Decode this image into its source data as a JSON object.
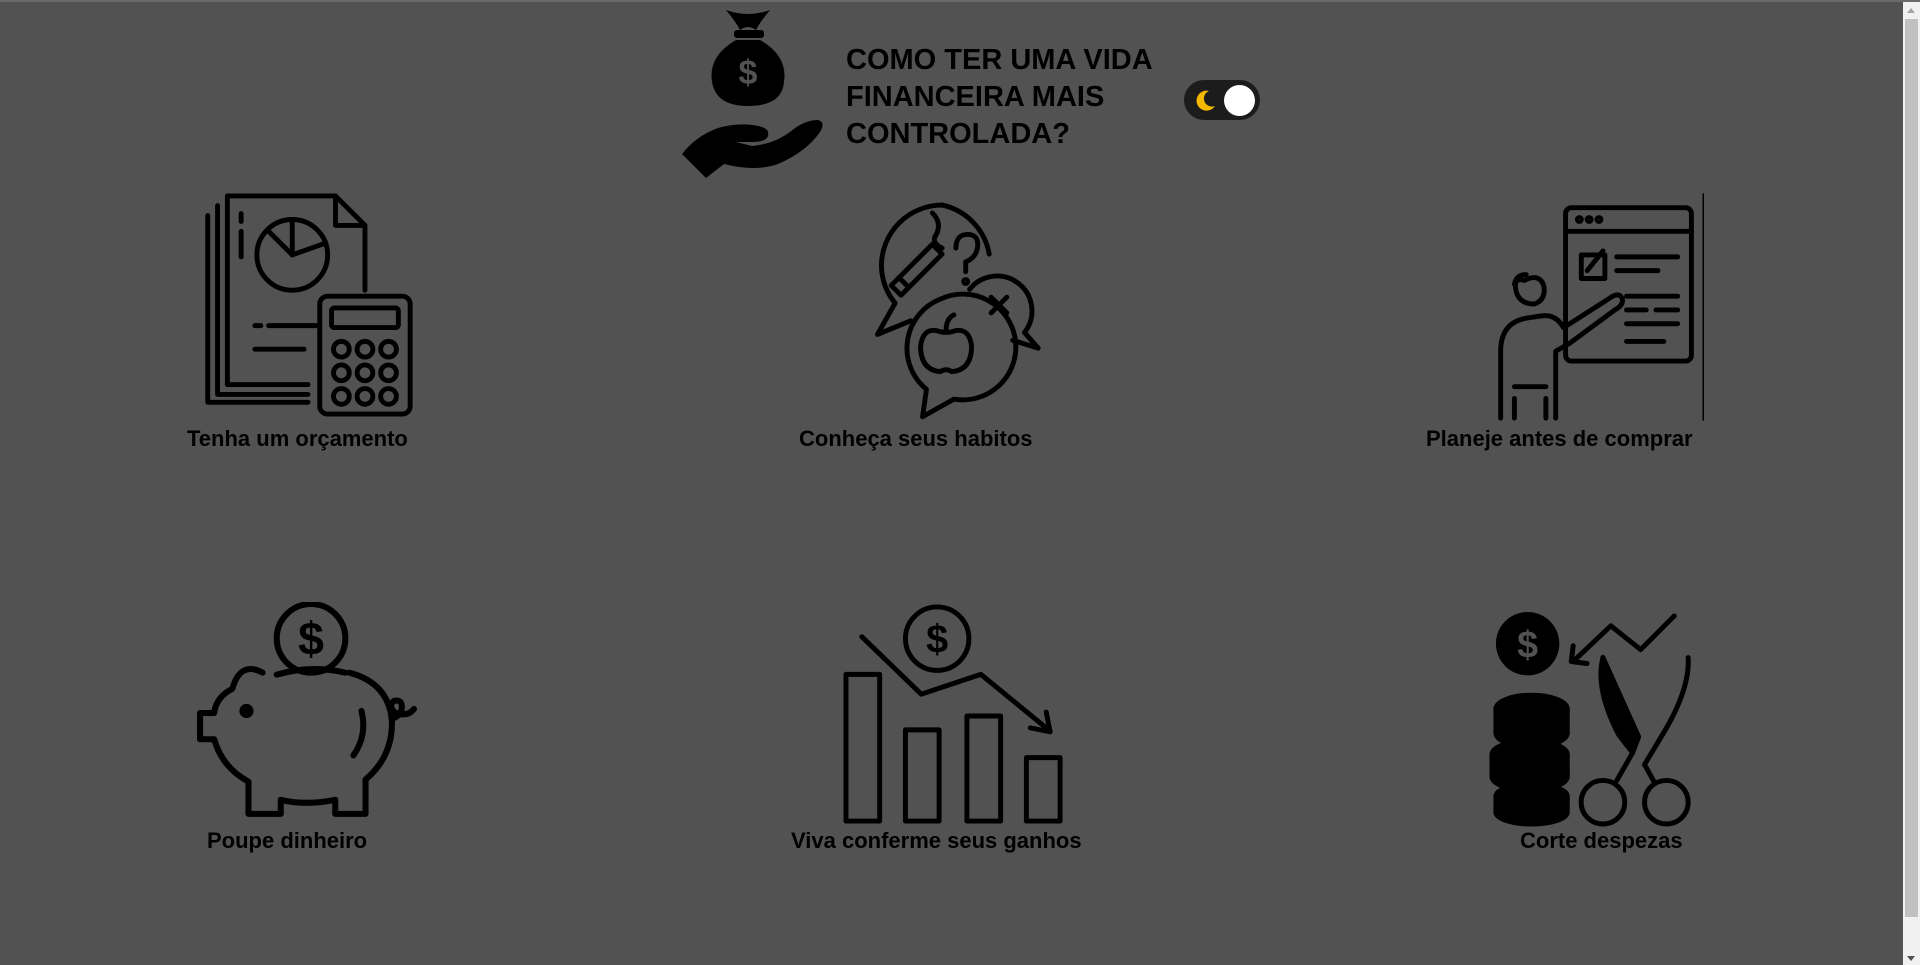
{
  "header": {
    "title": "COMO TER UMA VIDA FINANCEIRA MAIS CONTROLADA?",
    "logo_icon": "money-bag-hand-icon",
    "theme_toggle": {
      "icon": "moon-icon",
      "state": "dark"
    }
  },
  "colors": {
    "background": "#525252",
    "text": "#000000",
    "moon": "#f5b800",
    "knob": "#ffffff"
  },
  "cards": [
    {
      "label": "Tenha um orçamento",
      "icon": "budget-calculator-icon"
    },
    {
      "label": "Conheça seus habitos",
      "icon": "habits-speech-bubbles-icon"
    },
    {
      "label": "Planeje antes de comprar",
      "icon": "planning-board-icon"
    },
    {
      "label": "Poupe dinheiro",
      "icon": "piggy-bank-icon"
    },
    {
      "label": "Viva conferme seus ganhos",
      "icon": "falling-bar-chart-icon"
    },
    {
      "label": "Corte despezas",
      "icon": "cut-expenses-scissors-icon"
    }
  ]
}
